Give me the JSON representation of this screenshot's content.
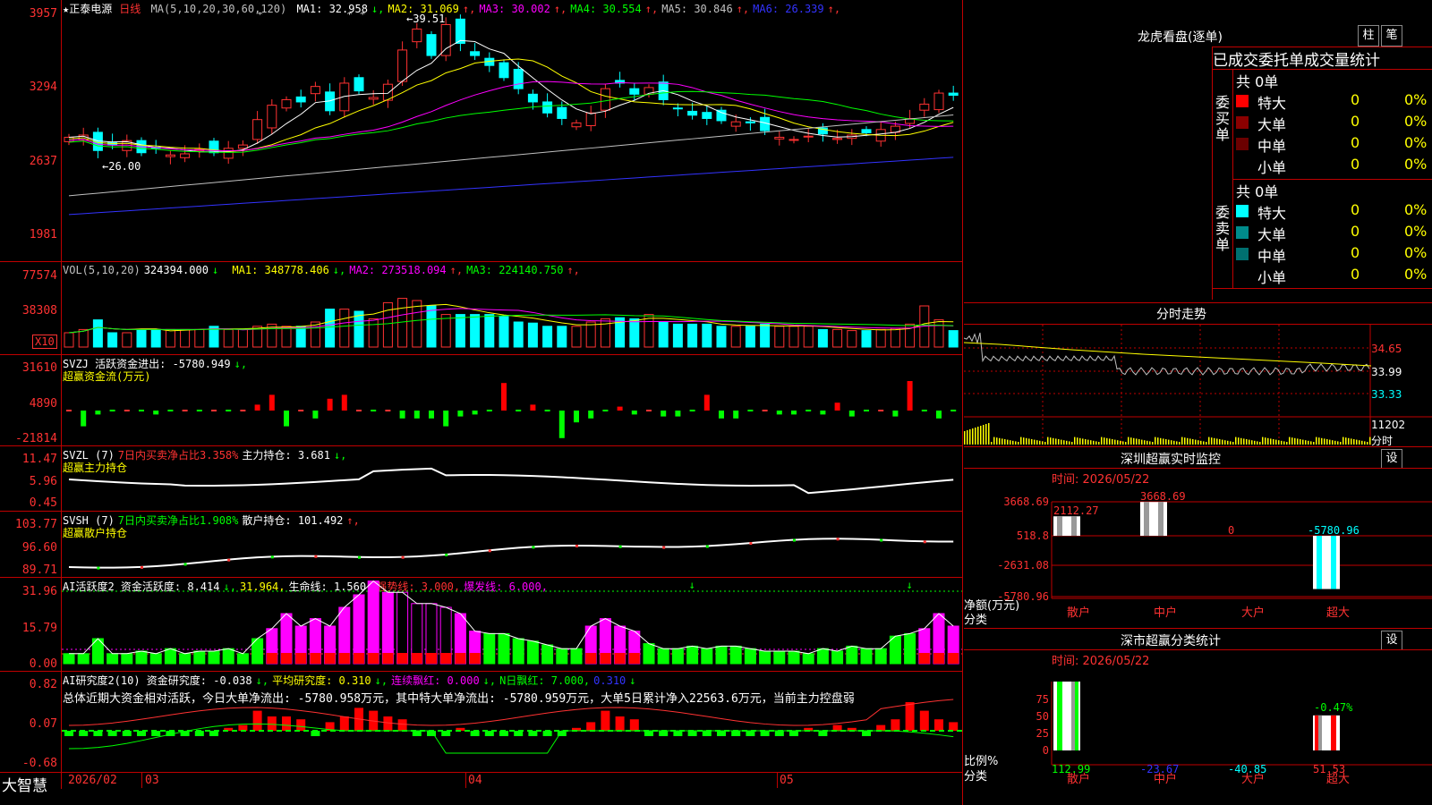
{
  "app": {
    "logo": "大智慧",
    "stock_name": "正泰电源",
    "period": "日线"
  },
  "main": {
    "ma_label": "MA(5,10,20,30,60,120)",
    "ma": [
      {
        "label": "MA1: 32.958",
        "arrow": "↓",
        "color": "#ffffff"
      },
      {
        "label": "MA2: 31.069",
        "arrow": "↑",
        "color": "#ffff00"
      },
      {
        "label": "MA3: 30.002",
        "arrow": "↑",
        "color": "#ff00ff"
      },
      {
        "label": "MA4: 30.554",
        "arrow": "↑",
        "color": "#00ff00"
      },
      {
        "label": "MA5: 30.846",
        "arrow": "↑",
        "color": "#c0c0c0"
      },
      {
        "label": "MA6: 26.339",
        "arrow": "↑",
        "color": "#3333ff"
      }
    ],
    "y_ticks": [
      "3957",
      "3294",
      "2637",
      "1981"
    ],
    "high_mark": "39.51",
    "low_mark": "26.00"
  },
  "vol": {
    "label": "VOL(5,10,20)",
    "value": "324394.000",
    "value_arrow": "↓",
    "ma": [
      {
        "label": "MA1: 348778.406",
        "arrow": "↓",
        "color": "#ffff00"
      },
      {
        "label": "MA2: 273518.094",
        "arrow": "↑",
        "color": "#ff00ff"
      },
      {
        "label": "MA3: 224140.750",
        "arrow": "↑",
        "color": "#00ff00"
      }
    ],
    "y_ticks": [
      "77574",
      "38308"
    ],
    "unit": "X10"
  },
  "svzj": {
    "line1": "SVZJ  活跃资金进出: -5780.949",
    "arrow": "↓,",
    "line2": "超赢资金流(万元)",
    "y_ticks": [
      "31610",
      "4890",
      "-21814"
    ]
  },
  "svzl": {
    "name": "SVZL (7)",
    "stat": "7日内买卖净占比3.358%",
    "hold": "主力持仓: 3.681",
    "arrow": "↓,",
    "line2": "超赢主力持仓",
    "y_ticks": [
      "11.47",
      "5.96",
      "0.45"
    ]
  },
  "svsh": {
    "name": "SVSH (7)",
    "stat": "7日内买卖净占比1.908%",
    "hold": "散户持仓: 101.492",
    "arrow": "↑,",
    "line2": "超赢散户持仓",
    "y_ticks": [
      "103.77",
      "96.60",
      "89.71"
    ]
  },
  "ai2": {
    "parts": [
      {
        "t": "AI活跃度2 资金活跃度: 8.414",
        "c": "#ffffff"
      },
      {
        "t": "↓,",
        "c": "#00ff00"
      },
      {
        "t": "31.964,",
        "c": "#ffff00"
      },
      {
        "t": "生命线: 1.560,",
        "c": "#ffffff"
      },
      {
        "t": "强势线: 3.000,",
        "c": "#ff3232"
      },
      {
        "t": "爆发线: 6.000,",
        "c": "#ff00ff"
      }
    ],
    "y_ticks": [
      "31.96",
      "15.79",
      "0.00"
    ]
  },
  "ai3": {
    "parts": [
      {
        "t": "AI研究度2(10) 资金研究度: -0.038",
        "c": "#ffffff"
      },
      {
        "t": "↓,",
        "c": "#00ff00"
      },
      {
        "t": "平均研究度: 0.310",
        "c": "#ffff00"
      },
      {
        "t": "↓,",
        "c": "#00ff00"
      },
      {
        "t": "连续飘红: 0.000",
        "c": "#ff00ff"
      },
      {
        "t": "↓,",
        "c": "#00ff00"
      },
      {
        "t": "N日飘红: 7.000,",
        "c": "#00ff00"
      },
      {
        "t": "0.310",
        "c": "#3333ff"
      },
      {
        "t": "↓",
        "c": "#00ff00"
      }
    ],
    "summary": "总体近期大资金相对活跃，今日大单净流出: -5780.958万元，其中特大单净流出: -5780.959万元，大单5日累计净入22563.6万元，当前主力控盘弱",
    "y_ticks": [
      "0.82",
      "0.07",
      "-0.68"
    ]
  },
  "xaxis": {
    "labels": [
      "2026/02",
      "03",
      "04",
      "05"
    ]
  },
  "dragon": {
    "title": "龙虎看盘(逐单)",
    "btn1": "柱",
    "btn2": "笔",
    "tabs": [
      "已成交",
      "委托单",
      "成交量统计"
    ],
    "buy": {
      "side": "委买单",
      "total": "共 0单",
      "rows": [
        {
          "name": "特大",
          "v": "0",
          "p": "0%",
          "color": "#ff0000"
        },
        {
          "name": "大单",
          "v": "0",
          "p": "0%",
          "color": "#8b0000"
        },
        {
          "name": "中单",
          "v": "0",
          "p": "0%",
          "color": "#6b0000"
        },
        {
          "name": "小单",
          "v": "0",
          "p": "0%",
          "color": "#000000"
        }
      ]
    },
    "sell": {
      "side": "委卖单",
      "total": "共 0单",
      "rows": [
        {
          "name": "特大",
          "v": "0",
          "p": "0%",
          "color": "#00ffff"
        },
        {
          "name": "大单",
          "v": "0",
          "p": "0%",
          "color": "#008b8b"
        },
        {
          "name": "中单",
          "v": "0",
          "p": "0%",
          "color": "#007070"
        },
        {
          "name": "小单",
          "v": "0",
          "p": "0%",
          "color": "#000000"
        }
      ]
    }
  },
  "intraday": {
    "title": "分时走势",
    "prices": [
      "34.65",
      "33.99",
      "33.33"
    ],
    "vol": "11202",
    "vol_unit": "分时"
  },
  "sz_monitor": {
    "title": "深圳超赢实时监控",
    "btn": "设",
    "time": "时间: 2026/05/22",
    "y_ticks": [
      "3668.69",
      "518.8",
      "-2631.08",
      "-5780.96"
    ],
    "ylabel": "净额(万元)",
    "xlabel": "分类",
    "cats": [
      "散户",
      "中户",
      "大户",
      "超大"
    ],
    "values": [
      2112.27,
      3668.69,
      0,
      -5780.96
    ],
    "value_labels": [
      "2112.27",
      "3668.69",
      "0",
      "-5780.96"
    ]
  },
  "sz_class": {
    "title": "深市超赢分类统计",
    "btn": "设",
    "time": "时间: 2026/05/22",
    "y_ticks": [
      "75",
      "50",
      "25",
      "0"
    ],
    "ylabel": "比例%",
    "xlabel": "分类",
    "cats": [
      "散户",
      "中户",
      "大户",
      "超大"
    ],
    "values": [
      112.99,
      -23.67,
      -40.85,
      51.53
    ],
    "value_labels": [
      "112.99",
      "-23.67",
      "-40.85",
      "51.53"
    ],
    "top_label": "-0.47%"
  }
}
